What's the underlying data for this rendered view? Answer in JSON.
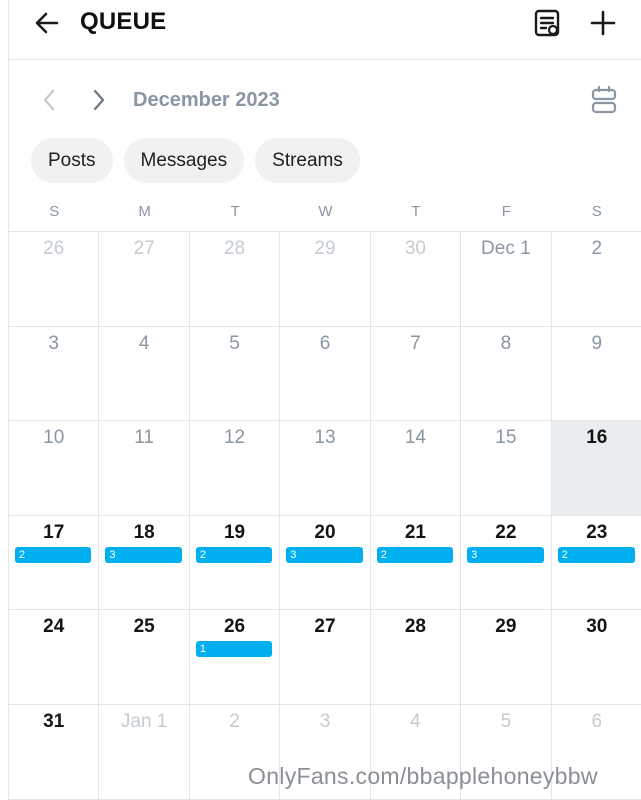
{
  "header": {
    "title": "QUEUE",
    "icons": {
      "back": "arrow-left-icon",
      "list": "queue-list-icon",
      "add": "plus-icon"
    }
  },
  "month_nav": {
    "label": "December 2023",
    "icons": {
      "prev": "chevron-left-icon",
      "next": "chevron-right-icon",
      "view": "calendar-view-icon"
    }
  },
  "filters": [
    "Posts",
    "Messages",
    "Streams"
  ],
  "weekdays": [
    "S",
    "M",
    "T",
    "W",
    "T",
    "F",
    "S"
  ],
  "calendar": {
    "cells": [
      {
        "label": "26",
        "state": "out"
      },
      {
        "label": "27",
        "state": "out"
      },
      {
        "label": "28",
        "state": "out"
      },
      {
        "label": "29",
        "state": "out"
      },
      {
        "label": "30",
        "state": "out"
      },
      {
        "label": "Dec 1",
        "state": "past"
      },
      {
        "label": "2",
        "state": "past"
      },
      {
        "label": "3",
        "state": "past"
      },
      {
        "label": "4",
        "state": "past"
      },
      {
        "label": "5",
        "state": "past"
      },
      {
        "label": "6",
        "state": "past"
      },
      {
        "label": "7",
        "state": "past"
      },
      {
        "label": "8",
        "state": "past"
      },
      {
        "label": "9",
        "state": "past"
      },
      {
        "label": "10",
        "state": "past"
      },
      {
        "label": "11",
        "state": "past"
      },
      {
        "label": "12",
        "state": "past"
      },
      {
        "label": "13",
        "state": "past"
      },
      {
        "label": "14",
        "state": "past"
      },
      {
        "label": "15",
        "state": "past"
      },
      {
        "label": "16",
        "state": "today"
      },
      {
        "label": "17",
        "state": "cur",
        "count": "2"
      },
      {
        "label": "18",
        "state": "cur",
        "count": "3"
      },
      {
        "label": "19",
        "state": "cur",
        "count": "2"
      },
      {
        "label": "20",
        "state": "cur",
        "count": "3"
      },
      {
        "label": "21",
        "state": "cur",
        "count": "2"
      },
      {
        "label": "22",
        "state": "cur",
        "count": "3"
      },
      {
        "label": "23",
        "state": "cur",
        "count": "2"
      },
      {
        "label": "24",
        "state": "cur"
      },
      {
        "label": "25",
        "state": "cur"
      },
      {
        "label": "26",
        "state": "cur",
        "count": "1"
      },
      {
        "label": "27",
        "state": "cur"
      },
      {
        "label": "28",
        "state": "cur"
      },
      {
        "label": "29",
        "state": "cur"
      },
      {
        "label": "30",
        "state": "cur"
      },
      {
        "label": "31",
        "state": "cur"
      },
      {
        "label": "Jan 1",
        "state": "out"
      },
      {
        "label": "2",
        "state": "out"
      },
      {
        "label": "3",
        "state": "out"
      },
      {
        "label": "4",
        "state": "out"
      },
      {
        "label": "5",
        "state": "out"
      },
      {
        "label": "6",
        "state": "out"
      }
    ]
  },
  "colors": {
    "accent": "#00aff0",
    "muted_text": "#8a96a3",
    "today_bg": "#eaedf0"
  },
  "watermark": "OnlyFans.com/bbapplehoneybbw"
}
